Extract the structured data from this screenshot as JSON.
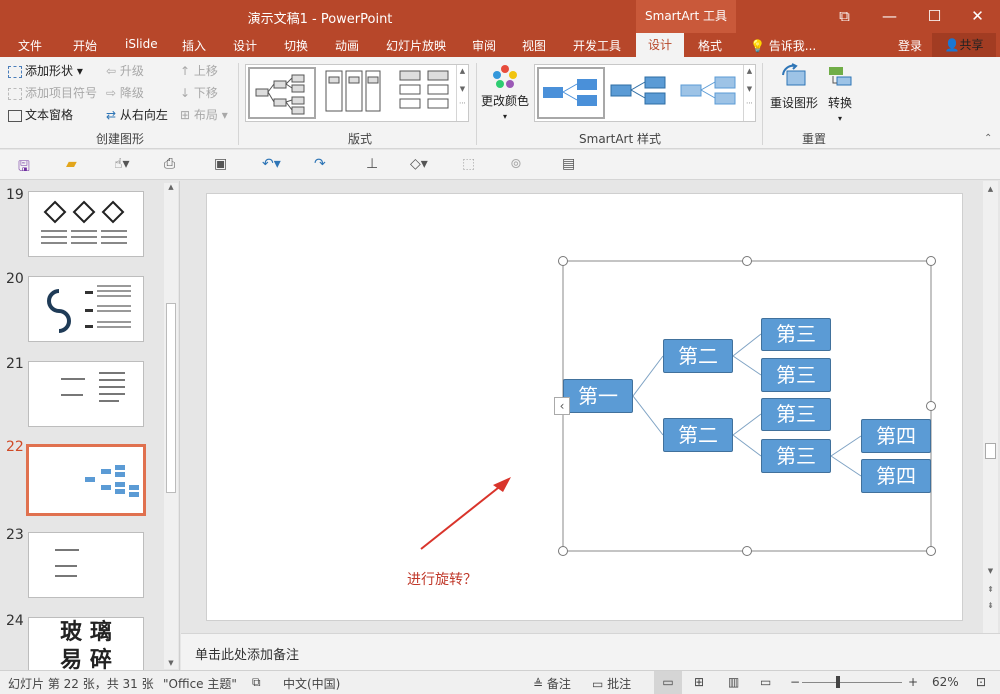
{
  "window": {
    "title": "演示文稿1 - PowerPoint",
    "context_tools": "SmartArt 工具",
    "minimize": "—",
    "restore": "☐",
    "close": "✕",
    "ribbon_toggle": "⧉"
  },
  "tabs": [
    {
      "label": "文件"
    },
    {
      "label": "开始"
    },
    {
      "label": "iSlide"
    },
    {
      "label": "插入"
    },
    {
      "label": "设计"
    },
    {
      "label": "切换"
    },
    {
      "label": "动画"
    },
    {
      "label": "幻灯片放映"
    },
    {
      "label": "审阅"
    },
    {
      "label": "视图"
    },
    {
      "label": "开发工具"
    },
    {
      "label": "设计"
    },
    {
      "label": "格式"
    }
  ],
  "tell_me": "告诉我...",
  "login": "登录",
  "share": "共享",
  "ribbon": {
    "create": {
      "add_shape": "添加形状",
      "add_bullet": "添加项目符号",
      "text_pane": "文本窗格",
      "promote": "升级",
      "demote": "降级",
      "right_to_left": "从右向左",
      "move_up": "上移",
      "move_down": "下移",
      "layout": "布局",
      "group_label": "创建图形"
    },
    "layouts": {
      "group_label": "版式"
    },
    "styles": {
      "change_colors": "更改颜色",
      "group_label": "SmartArt 样式"
    },
    "reset": {
      "reset_graphic": "重设图形",
      "convert": "转换",
      "group_label": "重置"
    }
  },
  "slides": [
    {
      "num": "19"
    },
    {
      "num": "20"
    },
    {
      "num": "21"
    },
    {
      "num": "22"
    },
    {
      "num": "23"
    },
    {
      "num": "24"
    }
  ],
  "slide24_text": {
    "line1": "玻 璃",
    "line2": "易 碎"
  },
  "smartart": {
    "n1": "第一",
    "n2a": "第二",
    "n2b": "第二",
    "n3a": "第三",
    "n3b": "第三",
    "n3c": "第三",
    "n3d": "第三",
    "n4a": "第四",
    "n4b": "第四",
    "pane_toggle": "‹"
  },
  "annotation": {
    "text": "进行旋转？",
    "color": "#c0392b"
  },
  "notes_placeholder": "单击此处添加备注",
  "status": {
    "slide_info": "幻灯片 第 22 张，共 31 张",
    "theme": "\"Office 主题\"",
    "language": "中文(中国)",
    "notes": "备注",
    "comments": "批注",
    "zoom": "62%",
    "zoom_minus": "−",
    "zoom_plus": "+"
  },
  "colors": {
    "accent": "#b7472a",
    "node": "#5b9bd5",
    "selected_thumb": "#e0714f"
  }
}
